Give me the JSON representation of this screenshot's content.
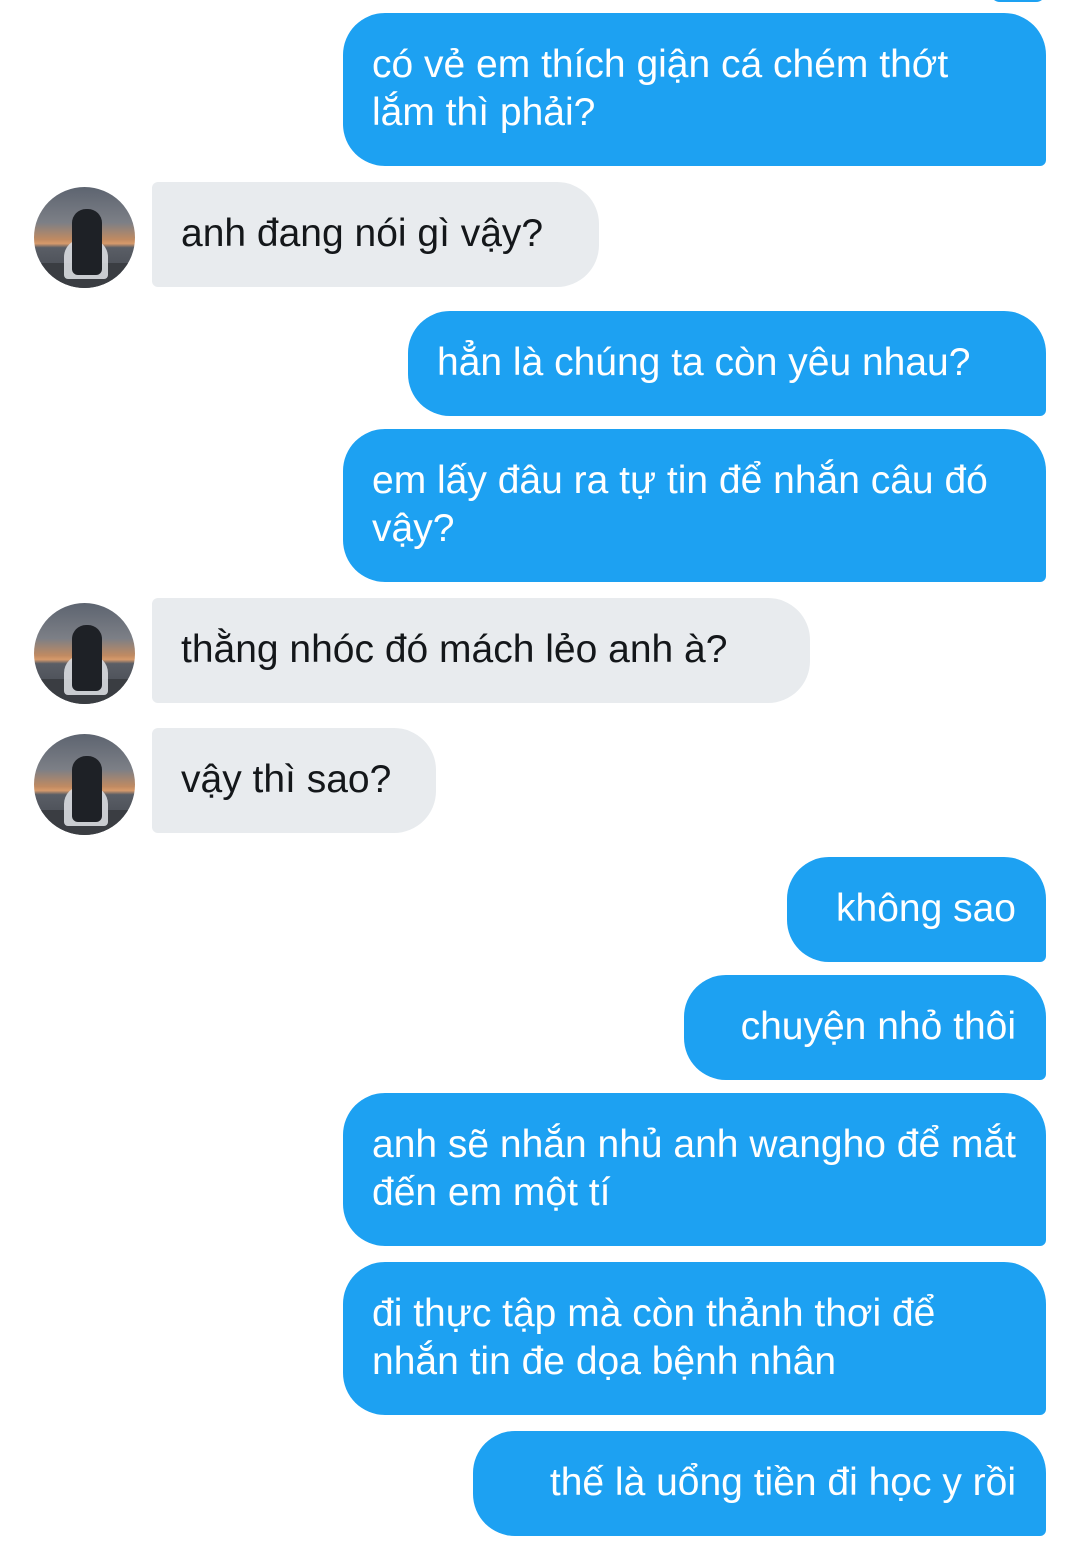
{
  "conversation": {
    "messages": [
      {
        "side": "sent",
        "text": "có vẻ em thích giận cá chém thớt lắm thì phải?"
      },
      {
        "side": "received",
        "text": "anh đang nói gì vậy?"
      },
      {
        "side": "sent",
        "text": "hẳn là chúng ta còn yêu nhau?"
      },
      {
        "side": "sent",
        "text": "em lấy đâu ra tự tin để nhắn câu đó vậy?"
      },
      {
        "side": "received",
        "text": "thằng nhóc đó mách lẻo anh à?"
      },
      {
        "side": "received",
        "text": "vậy thì sao?"
      },
      {
        "side": "sent",
        "text": "không sao"
      },
      {
        "side": "sent",
        "text": "chuyện nhỏ thôi"
      },
      {
        "side": "sent",
        "text": "anh sẽ nhắn nhủ anh wangho để mắt đến em một tí"
      },
      {
        "side": "sent",
        "text": "đi thực tập mà còn thảnh thơi để nhắn tin đe dọa bệnh nhân"
      },
      {
        "side": "sent",
        "text": "thế là uổng tiền đi học y rồi"
      }
    ]
  },
  "colors": {
    "sent_bubble": "#1da1f2",
    "received_bubble": "#e8ebee",
    "background": "#ffffff"
  }
}
